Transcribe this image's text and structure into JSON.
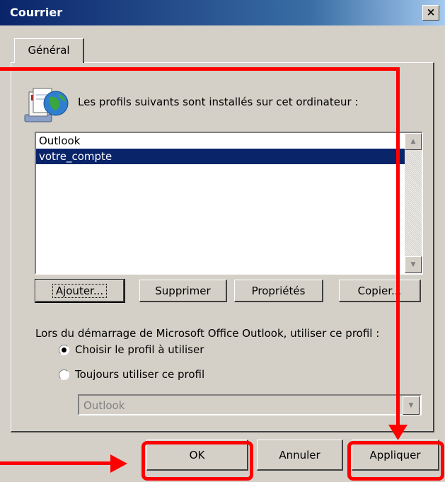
{
  "window": {
    "title": "Courrier",
    "close_label": "×"
  },
  "tabs": [
    {
      "label": "Général"
    }
  ],
  "info_text": "Les profils suivants sont installés sur cet ordinateur :",
  "info_icon": "profiles-computer-icon",
  "profiles": [
    {
      "name": "Outlook",
      "selected": false
    },
    {
      "name": "votre_compte",
      "selected": true
    }
  ],
  "profile_buttons": {
    "add": "Ajouter...",
    "remove": "Supprimer",
    "properties": "Propriétés",
    "copy": "Copier..."
  },
  "startup": {
    "label": "Lors du démarrage de Microsoft Office Outlook, utiliser ce profil :",
    "option_choose": "Choisir le profil à utiliser",
    "option_always": "Toujours utiliser ce profil",
    "selected_option": "choose",
    "profile_select_value": "Outlook"
  },
  "dialog_buttons": {
    "ok": "OK",
    "cancel": "Annuler",
    "apply": "Appliquer"
  },
  "colors": {
    "titlebar": "#0a246a",
    "dialog_face": "#d4d0c8",
    "selection": "#0a246a",
    "annotation": "#ff0000"
  }
}
